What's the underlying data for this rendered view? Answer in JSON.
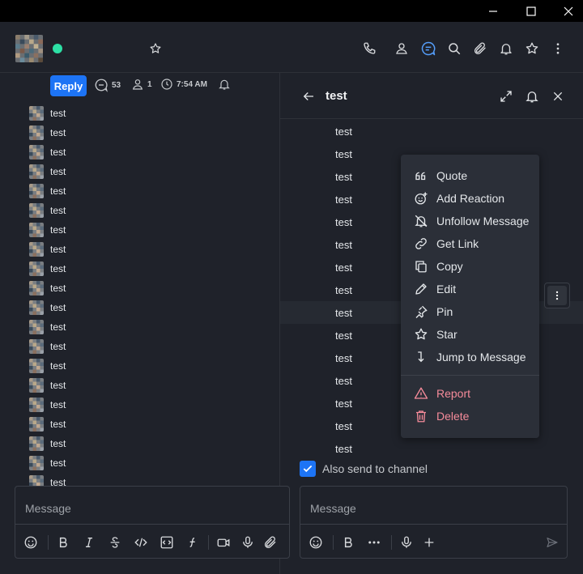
{
  "window": {
    "minimize_icon": "minimize-icon",
    "maximize_icon": "maximize-icon",
    "close_icon": "close-icon"
  },
  "room": {
    "status_color": "#2de0a5",
    "header_icons": [
      "star-icon",
      "phone-icon",
      "user-icon",
      "threads-icon",
      "search-icon",
      "paperclip-icon",
      "bell-icon",
      "star-icon",
      "kebab-icon"
    ]
  },
  "thread_meta": {
    "reply_label": "Reply",
    "replies_count": "53",
    "followers_count": "1",
    "time": "7:54 AM"
  },
  "left_messages": [
    "test",
    "test",
    "test",
    "test",
    "test",
    "test",
    "test",
    "test",
    "test",
    "test",
    "test",
    "test",
    "test",
    "test",
    "test",
    "test",
    "test",
    "test",
    "test",
    "test"
  ],
  "composer_left": {
    "placeholder": "Message"
  },
  "thread_panel": {
    "title": "test",
    "messages": [
      "test",
      "test",
      "test",
      "test",
      "test",
      "test",
      "test",
      "test",
      "test",
      "test",
      "test",
      "test",
      "test",
      "test",
      "test"
    ],
    "also_send_label": "Also send to channel",
    "composer_placeholder": "Message"
  },
  "context_menu": {
    "items": [
      {
        "label": "Quote",
        "icon": "quote-icon"
      },
      {
        "label": "Add Reaction",
        "icon": "add-reaction-icon"
      },
      {
        "label": "Unfollow Message",
        "icon": "bell-off-icon"
      },
      {
        "label": "Get Link",
        "icon": "link-icon"
      },
      {
        "label": "Copy",
        "icon": "copy-icon"
      },
      {
        "label": "Edit",
        "icon": "pencil-icon"
      },
      {
        "label": "Pin",
        "icon": "pin-icon"
      },
      {
        "label": "Star",
        "icon": "star-icon"
      },
      {
        "label": "Jump to Message",
        "icon": "jump-icon"
      }
    ],
    "danger_items": [
      {
        "label": "Report",
        "icon": "warning-icon"
      },
      {
        "label": "Delete",
        "icon": "trash-icon"
      }
    ]
  },
  "colors": {
    "accent": "#1d74f5",
    "danger": "#f58b9a",
    "background": "#1f222a",
    "menu": "#2b2f38"
  }
}
